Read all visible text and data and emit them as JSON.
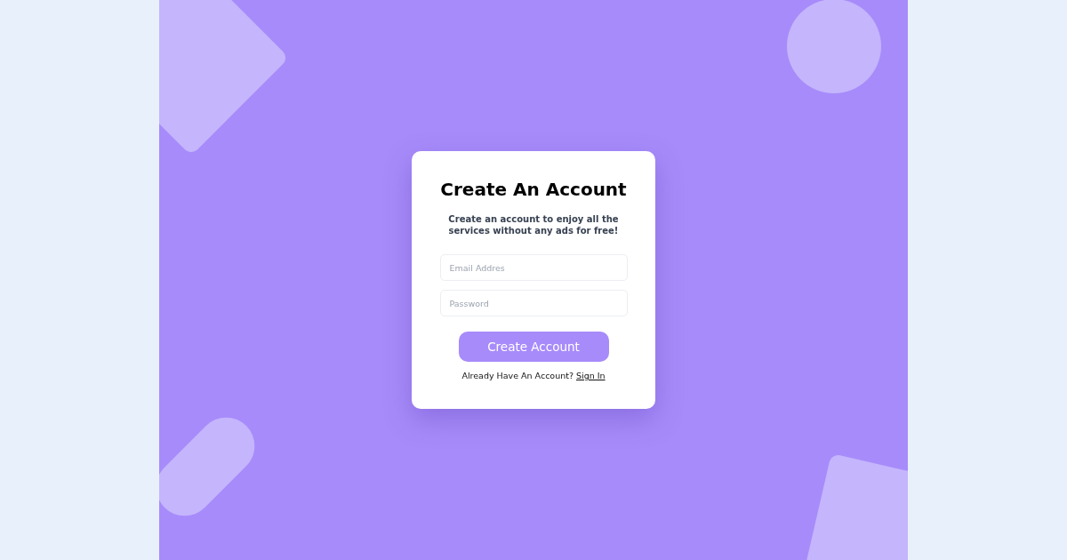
{
  "card": {
    "title": "Create An Account",
    "subtitle": "Create an account to enjoy all the services without any ads for free!"
  },
  "fields": [
    {
      "placeholder": "Email Addres"
    },
    {
      "placeholder": "Password"
    }
  ],
  "button": "Create Account",
  "footer": {
    "text": "Already Have An Account?",
    "link": "Sign In"
  }
}
